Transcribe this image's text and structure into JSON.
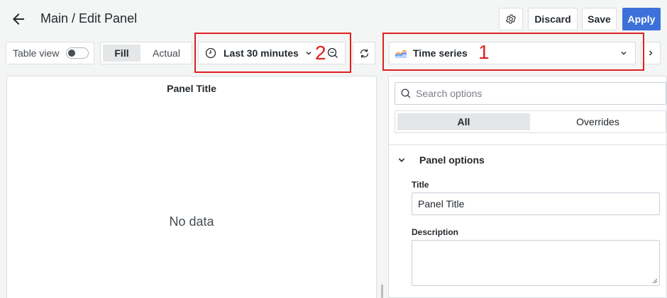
{
  "header": {
    "title": "Main / Edit Panel",
    "discard_label": "Discard",
    "save_label": "Save",
    "apply_label": "Apply"
  },
  "toolbar": {
    "table_view_label": "Table view",
    "fill_label": "Fill",
    "actual_label": "Actual",
    "time_range_label": "Last 30 minutes",
    "visualization_label": "Time series"
  },
  "annotations": {
    "one": "1",
    "two": "2"
  },
  "preview": {
    "panel_title": "Panel Title",
    "empty_text": "No data"
  },
  "options": {
    "search_placeholder": "Search options",
    "tab_all": "All",
    "tab_overrides": "Overrides",
    "section_title": "Panel options",
    "title_label": "Title",
    "title_value": "Panel Title",
    "description_label": "Description"
  },
  "colors": {
    "accent": "#3d71d9",
    "annotation": "#e02020"
  }
}
